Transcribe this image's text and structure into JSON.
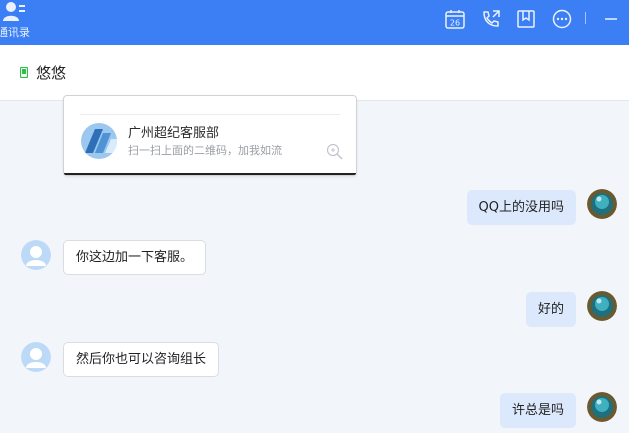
{
  "topbar": {
    "contacts_label": "通讯录",
    "calendar_day": "26",
    "icons": [
      "contacts-icon",
      "calendar-icon",
      "phone-call-icon",
      "bookmark-icon",
      "more-icon",
      "minimize-icon"
    ],
    "accent": "#3c7ef4"
  },
  "chat": {
    "title": "悠悠",
    "status_icon": "mobile-phone-icon"
  },
  "card": {
    "name": "广州超纪客服部",
    "description": "扫一扫上面的二维码，加我如流"
  },
  "messages": [
    {
      "sender": "self",
      "text": "QQ上的没用吗"
    },
    {
      "sender": "other",
      "text": "你这边加一下客服。"
    },
    {
      "sender": "self",
      "text": "好的"
    },
    {
      "sender": "other",
      "text": "然后你也可以咨询组长"
    },
    {
      "sender": "self",
      "text": "许总是吗"
    }
  ],
  "colors": {
    "self_bubble": "#dce9fc",
    "other_bubble": "#ffffff",
    "background": "#f2f5f9"
  }
}
